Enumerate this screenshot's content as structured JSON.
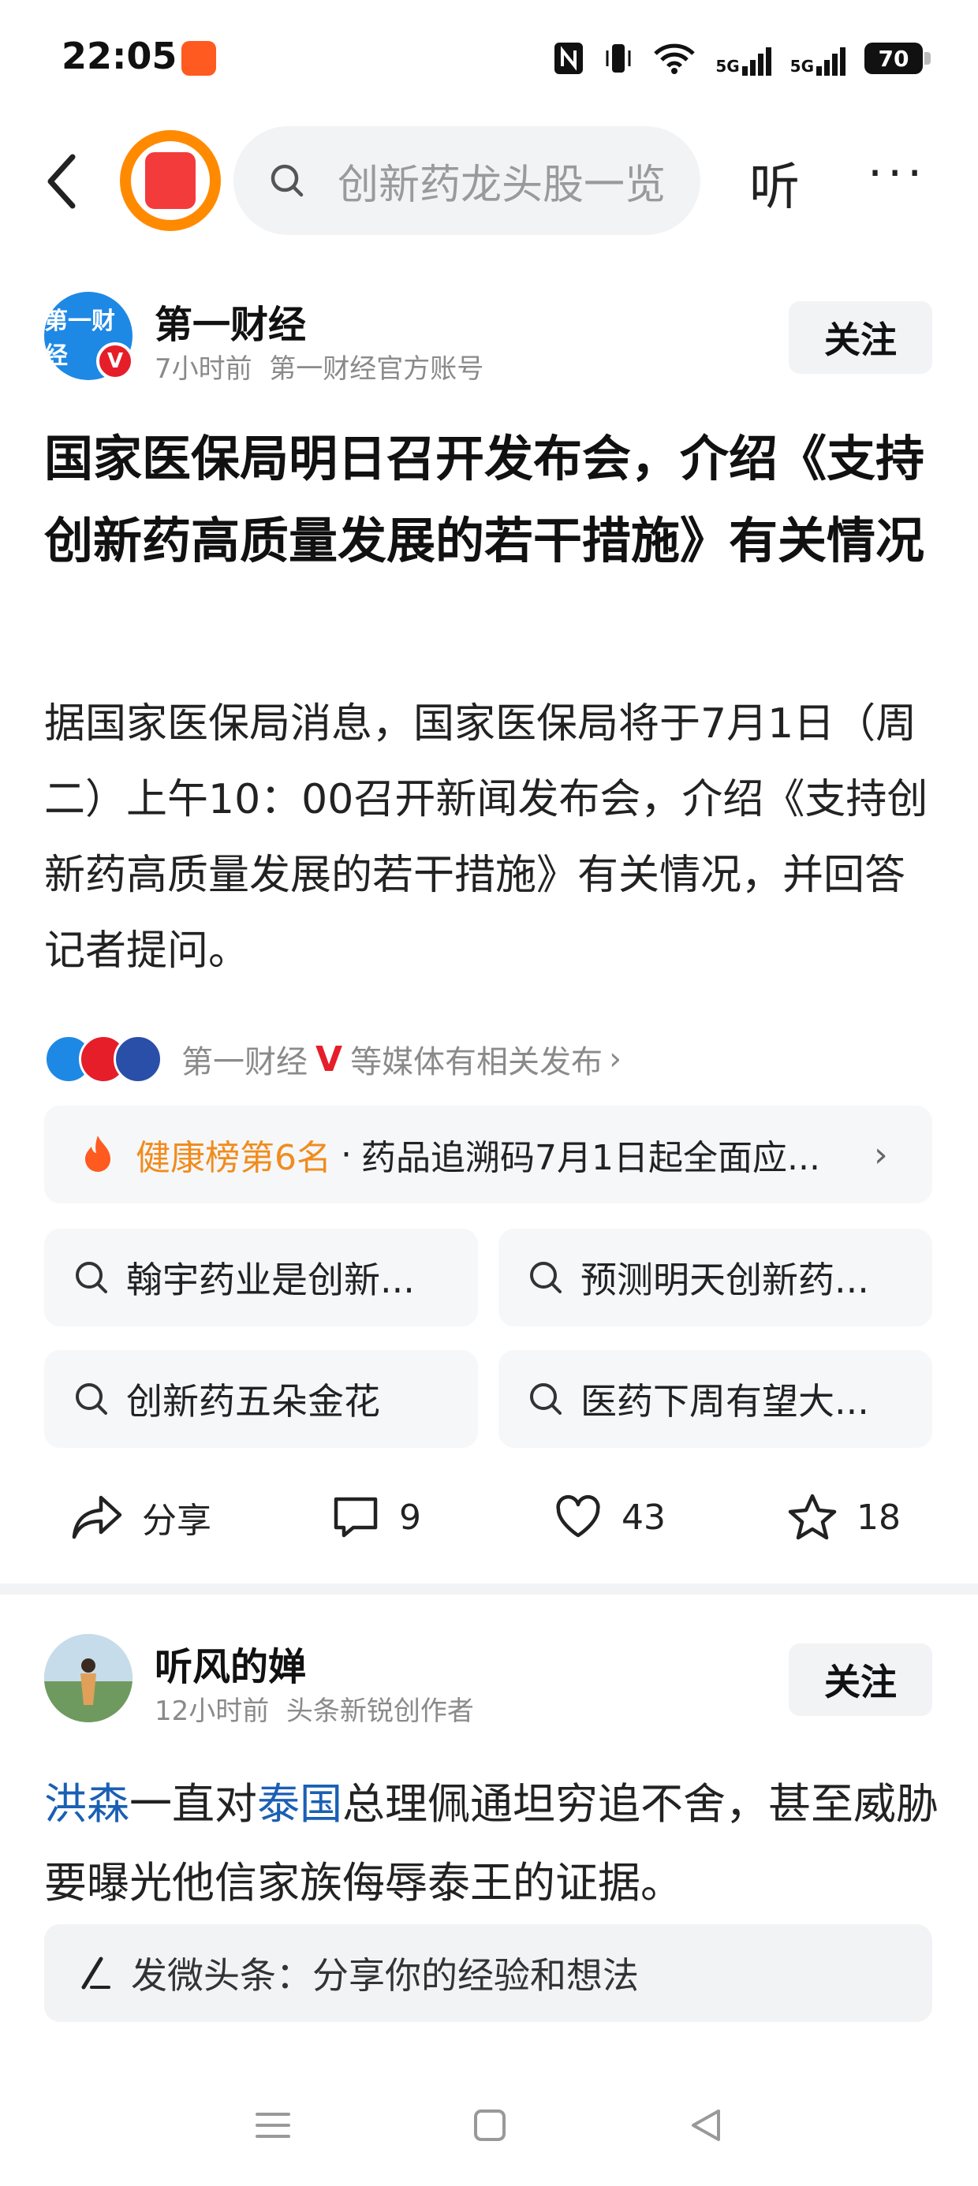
{
  "status_bar": {
    "time": "22:05",
    "network_label": "5G",
    "battery": "70"
  },
  "top_bar": {
    "search_placeholder": "创新药龙头股一览",
    "listen_label": "听",
    "more_label": "···"
  },
  "article": {
    "author_logo_text": "第一财经",
    "author_name": "第一财经",
    "time": "7小时前",
    "account_desc": "第一财经官方账号",
    "follow_label": "关注",
    "headline": "国家医保局明日召开发布会，介绍《支持创新药高质量发展的若干措施》有关情况",
    "body": "据国家医保局消息，国家医保局将于7月1日（周二）上午10：00召开新闻发布会，介绍《支持创新药高质量发展的若干措施》有关情况，并回答记者提问。",
    "related": {
      "source": "第一财经",
      "v_mark": "V",
      "suffix": "等媒体有相关发布"
    },
    "ranking": {
      "label": "健康榜第6名",
      "separator": "·",
      "topic": "药品追溯码7月1日起全面应..."
    },
    "search_chips": [
      "翰宇药业是创新...",
      "预测明天创新药...",
      "创新药五朵金花",
      "医药下周有望大..."
    ],
    "actions": {
      "share": "分享",
      "comments": "9",
      "likes": "43",
      "favorites": "18"
    }
  },
  "post": {
    "author_name": "听风的婵",
    "time": "12小时前",
    "author_desc": "头条新锐创作者",
    "follow_label": "关注",
    "link1": "洪森",
    "text1": "一直对",
    "link2": "泰国",
    "text2": "总理佩通坦穷追不舍，甚至威胁要曝光他信家族侮辱泰王的证据。"
  },
  "compose": {
    "placeholder": "发微头条：分享你的经验和想法"
  },
  "colors": {
    "accent_orange": "#f08c1d",
    "link_blue": "#1a5fb4",
    "verified_red": "#e51e2a"
  }
}
